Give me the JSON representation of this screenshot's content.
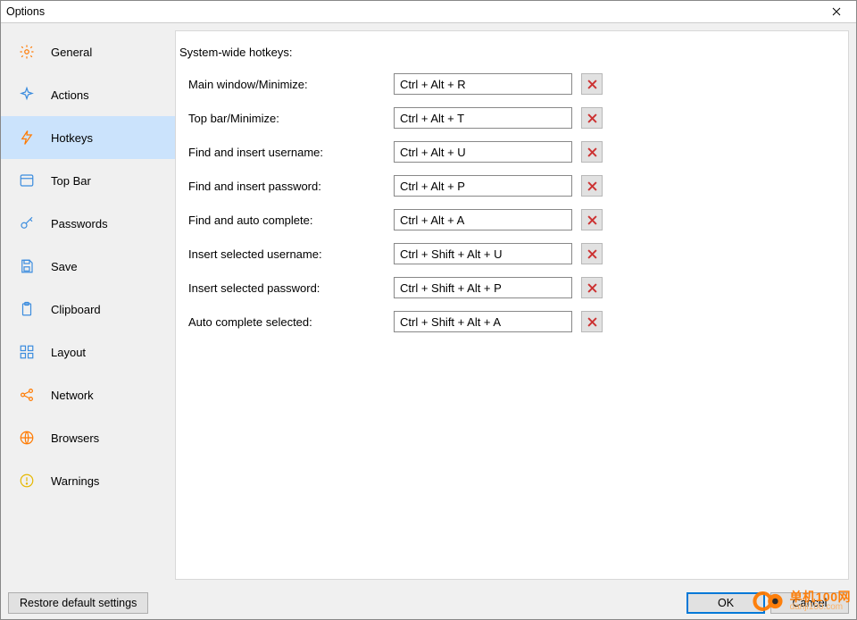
{
  "window": {
    "title": "Options"
  },
  "sidebar": {
    "items": [
      {
        "label": "General"
      },
      {
        "label": "Actions"
      },
      {
        "label": "Hotkeys"
      },
      {
        "label": "Top Bar"
      },
      {
        "label": "Passwords"
      },
      {
        "label": "Save"
      },
      {
        "label": "Clipboard"
      },
      {
        "label": "Layout"
      },
      {
        "label": "Network"
      },
      {
        "label": "Browsers"
      },
      {
        "label": "Warnings"
      }
    ],
    "selected_index": 2
  },
  "main": {
    "section_title": "System-wide hotkeys:",
    "hotkeys": [
      {
        "label": "Main window/Minimize:",
        "value": "Ctrl + Alt + R"
      },
      {
        "label": "Top bar/Minimize:",
        "value": "Ctrl + Alt + T"
      },
      {
        "label": "Find and insert username:",
        "value": "Ctrl + Alt + U"
      },
      {
        "label": "Find and insert password:",
        "value": "Ctrl + Alt + P"
      },
      {
        "label": "Find and auto complete:",
        "value": "Ctrl + Alt + A"
      },
      {
        "label": "Insert selected username:",
        "value": "Ctrl + Shift + Alt + U"
      },
      {
        "label": "Insert selected password:",
        "value": "Ctrl + Shift + Alt + P"
      },
      {
        "label": "Auto complete selected:",
        "value": "Ctrl + Shift + Alt + A"
      }
    ]
  },
  "footer": {
    "restore": "Restore default settings",
    "ok": "OK",
    "cancel": "Cancel"
  },
  "watermark": {
    "cn": "单机100网",
    "url": "danji100.com"
  },
  "colors": {
    "orange": "#ff7a00",
    "blue": "#3b8cde",
    "red_x": "#cc3333"
  }
}
